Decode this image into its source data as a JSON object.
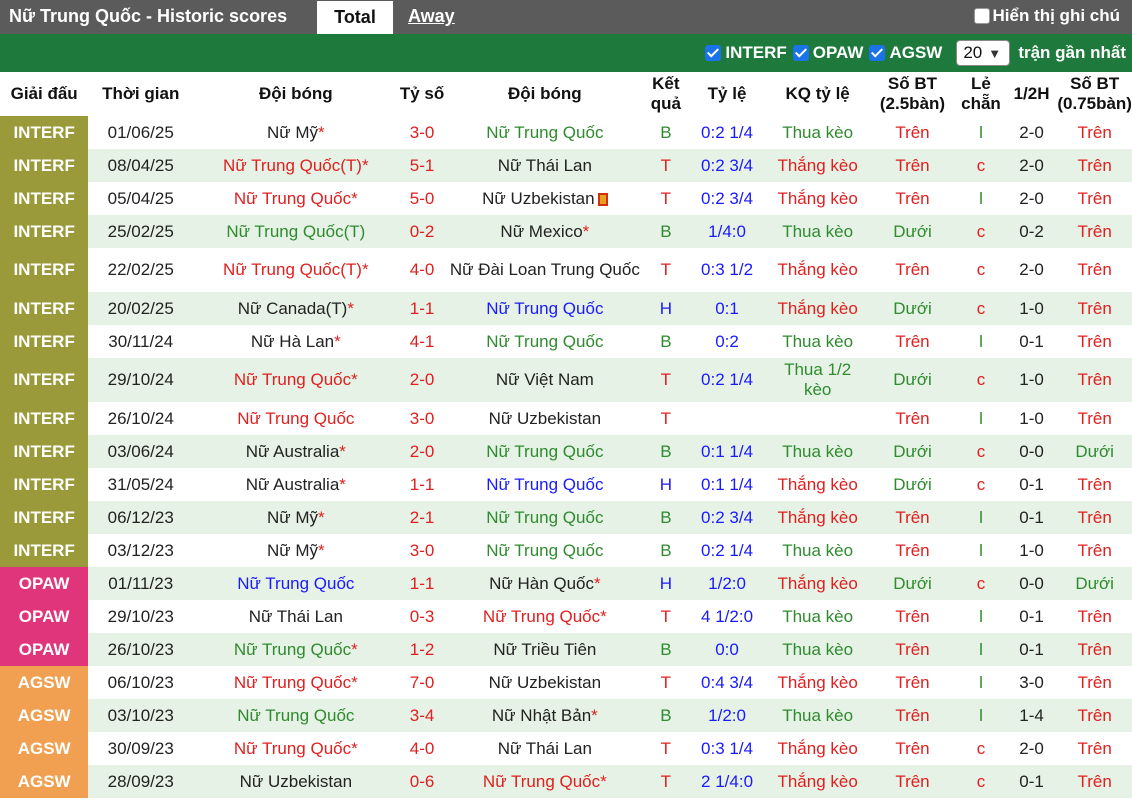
{
  "header": {
    "title": "Nữ Trung Quốc - Historic scores",
    "tab_total": "Total",
    "tab_away": "Away",
    "notes_label": "Hiển thị ghi chú"
  },
  "filters": {
    "items": [
      "INTERF",
      "OPAW",
      "AGSW"
    ],
    "count": "20",
    "count_suffix": "trận gần nhất"
  },
  "colors": {
    "INTERF": "#9a9a3a",
    "OPAW": "#e0357a",
    "AGSW": "#f0a050",
    "header_bar": "#5b5b5b",
    "filter_bar": "#1e7a3c"
  },
  "columns": [
    "Giải đấu",
    "Thời gian",
    "Đội bóng",
    "Tỷ số",
    "Đội bóng",
    "Kết quả",
    "Tỷ lệ",
    "KQ tỷ lệ",
    "Số BT (2.5bàn)",
    "Lẻ chẵn",
    "1/2H",
    "Số BT (0.75bàn)"
  ],
  "rows": [
    {
      "league": "INTERF",
      "date": "01/06/25",
      "home": "Nữ Mỹ",
      "hs": "*",
      "hc": "black",
      "score": "3-0",
      "away": "Nữ Trung Quốc",
      "as": "",
      "ac": "green",
      "res": "B",
      "odds": "0:2 1/4",
      "ko": "Thua kèo",
      "ou": "Trên",
      "oe": "l",
      "ht": "2-0",
      "ou2": "Trên"
    },
    {
      "league": "INTERF",
      "date": "08/04/25",
      "home": "Nữ Trung Quốc(T)",
      "hs": "*",
      "hc": "red",
      "score": "5-1",
      "away": "Nữ Thái Lan",
      "as": "",
      "ac": "black",
      "res": "T",
      "odds": "0:2 3/4",
      "ko": "Thắng kèo",
      "ou": "Trên",
      "oe": "c",
      "ht": "2-0",
      "ou2": "Trên"
    },
    {
      "league": "INTERF",
      "date": "05/04/25",
      "home": "Nữ Trung Quốc",
      "hs": "*",
      "hc": "red",
      "score": "5-0",
      "away": "Nữ Uzbekistan",
      "as": "",
      "ac": "black",
      "flag": true,
      "res": "T",
      "odds": "0:2 3/4",
      "ko": "Thắng kèo",
      "ou": "Trên",
      "oe": "l",
      "ht": "2-0",
      "ou2": "Trên"
    },
    {
      "league": "INTERF",
      "date": "25/02/25",
      "home": "Nữ Trung Quốc(T)",
      "hs": "",
      "hc": "green",
      "score": "0-2",
      "away": "Nữ Mexico",
      "as": "*",
      "ac": "black",
      "res": "B",
      "odds": "1/4:0",
      "ko": "Thua kèo",
      "ou": "Dưới",
      "oe": "c",
      "ht": "0-2",
      "ou2": "Trên"
    },
    {
      "league": "INTERF",
      "date": "22/02/25",
      "home": "Nữ Trung Quốc(T)",
      "hs": "*",
      "hc": "red",
      "score": "4-0",
      "away": "Nữ Đài Loan Trung Quốc",
      "as": "",
      "ac": "black",
      "res": "T",
      "odds": "0:3 1/2",
      "ko": "Thắng kèo",
      "ou": "Trên",
      "oe": "c",
      "ht": "2-0",
      "ou2": "Trên",
      "tall": true
    },
    {
      "league": "INTERF",
      "date": "20/02/25",
      "home": "Nữ Canada(T)",
      "hs": "*",
      "hc": "black",
      "score": "1-1",
      "away": "Nữ Trung Quốc",
      "as": "",
      "ac": "blue",
      "res": "H",
      "odds": "0:1",
      "ko": "Thắng kèo",
      "ou": "Dưới",
      "oe": "c",
      "ht": "1-0",
      "ou2": "Trên"
    },
    {
      "league": "INTERF",
      "date": "30/11/24",
      "home": "Nữ Hà Lan",
      "hs": "*",
      "hc": "black",
      "score": "4-1",
      "away": "Nữ Trung Quốc",
      "as": "",
      "ac": "green",
      "res": "B",
      "odds": "0:2",
      "ko": "Thua kèo",
      "ou": "Trên",
      "oe": "l",
      "ht": "0-1",
      "ou2": "Trên"
    },
    {
      "league": "INTERF",
      "date": "29/10/24",
      "home": "Nữ Trung Quốc",
      "hs": "*",
      "hc": "red",
      "score": "2-0",
      "away": "Nữ Việt Nam",
      "as": "",
      "ac": "black",
      "res": "T",
      "odds": "0:2 1/4",
      "ko": "Thua 1/2 kèo",
      "ou": "Dưới",
      "oe": "c",
      "ht": "1-0",
      "ou2": "Trên",
      "tall": true
    },
    {
      "league": "INTERF",
      "date": "26/10/24",
      "home": "Nữ Trung Quốc",
      "hs": "",
      "hc": "red",
      "score": "3-0",
      "away": "Nữ Uzbekistan",
      "as": "",
      "ac": "black",
      "res": "T",
      "odds": "",
      "ko": "",
      "ou": "Trên",
      "oe": "l",
      "ht": "1-0",
      "ou2": "Trên"
    },
    {
      "league": "INTERF",
      "date": "03/06/24",
      "home": "Nữ Australia",
      "hs": "*",
      "hc": "black",
      "score": "2-0",
      "away": "Nữ Trung Quốc",
      "as": "",
      "ac": "green",
      "res": "B",
      "odds": "0:1 1/4",
      "ko": "Thua kèo",
      "ou": "Dưới",
      "oe": "c",
      "ht": "0-0",
      "ou2": "Dưới"
    },
    {
      "league": "INTERF",
      "date": "31/05/24",
      "home": "Nữ Australia",
      "hs": "*",
      "hc": "black",
      "score": "1-1",
      "away": "Nữ Trung Quốc",
      "as": "",
      "ac": "blue",
      "res": "H",
      "odds": "0:1 1/4",
      "ko": "Thắng kèo",
      "ou": "Dưới",
      "oe": "c",
      "ht": "0-1",
      "ou2": "Trên"
    },
    {
      "league": "INTERF",
      "date": "06/12/23",
      "home": "Nữ Mỹ",
      "hs": "*",
      "hc": "black",
      "score": "2-1",
      "away": "Nữ Trung Quốc",
      "as": "",
      "ac": "green",
      "res": "B",
      "odds": "0:2 3/4",
      "ko": "Thắng kèo",
      "ou": "Trên",
      "oe": "l",
      "ht": "0-1",
      "ou2": "Trên"
    },
    {
      "league": "INTERF",
      "date": "03/12/23",
      "home": "Nữ Mỹ",
      "hs": "*",
      "hc": "black",
      "score": "3-0",
      "away": "Nữ Trung Quốc",
      "as": "",
      "ac": "green",
      "res": "B",
      "odds": "0:2 1/4",
      "ko": "Thua kèo",
      "ou": "Trên",
      "oe": "l",
      "ht": "1-0",
      "ou2": "Trên"
    },
    {
      "league": "OPAW",
      "date": "01/11/23",
      "home": "Nữ Trung Quốc",
      "hs": "",
      "hc": "blue",
      "score": "1-1",
      "away": "Nữ Hàn Quốc",
      "as": "*",
      "ac": "black",
      "res": "H",
      "odds": "1/2:0",
      "ko": "Thắng kèo",
      "ou": "Dưới",
      "oe": "c",
      "ht": "0-0",
      "ou2": "Dưới"
    },
    {
      "league": "OPAW",
      "date": "29/10/23",
      "home": "Nữ Thái Lan",
      "hs": "",
      "hc": "black",
      "score": "0-3",
      "away": "Nữ Trung Quốc",
      "as": "*",
      "ac": "red",
      "res": "T",
      "odds": "4 1/2:0",
      "ko": "Thua kèo",
      "ou": "Trên",
      "oe": "l",
      "ht": "0-1",
      "ou2": "Trên"
    },
    {
      "league": "OPAW",
      "date": "26/10/23",
      "home": "Nữ Trung Quốc",
      "hs": "*",
      "hc": "green",
      "score": "1-2",
      "away": "Nữ Triều Tiên",
      "as": "",
      "ac": "black",
      "res": "B",
      "odds": "0:0",
      "ko": "Thua kèo",
      "ou": "Trên",
      "oe": "l",
      "ht": "0-1",
      "ou2": "Trên"
    },
    {
      "league": "AGSW",
      "date": "06/10/23",
      "home": "Nữ Trung Quốc",
      "hs": "*",
      "hc": "red",
      "score": "7-0",
      "away": "Nữ Uzbekistan",
      "as": "",
      "ac": "black",
      "res": "T",
      "odds": "0:4 3/4",
      "ko": "Thắng kèo",
      "ou": "Trên",
      "oe": "l",
      "ht": "3-0",
      "ou2": "Trên"
    },
    {
      "league": "AGSW",
      "date": "03/10/23",
      "home": "Nữ Trung Quốc",
      "hs": "",
      "hc": "green",
      "score": "3-4",
      "away": "Nữ Nhật Bản",
      "as": "*",
      "ac": "black",
      "res": "B",
      "odds": "1/2:0",
      "ko": "Thua kèo",
      "ou": "Trên",
      "oe": "l",
      "ht": "1-4",
      "ou2": "Trên"
    },
    {
      "league": "AGSW",
      "date": "30/09/23",
      "home": "Nữ Trung Quốc",
      "hs": "*",
      "hc": "red",
      "score": "4-0",
      "away": "Nữ Thái Lan",
      "as": "",
      "ac": "black",
      "res": "T",
      "odds": "0:3 1/4",
      "ko": "Thắng kèo",
      "ou": "Trên",
      "oe": "c",
      "ht": "2-0",
      "ou2": "Trên"
    },
    {
      "league": "AGSW",
      "date": "28/09/23",
      "home": "Nữ Uzbekistan",
      "hs": "",
      "hc": "black",
      "score": "0-6",
      "away": "Nữ Trung Quốc",
      "as": "*",
      "ac": "red",
      "res": "T",
      "odds": "2 1/4:0",
      "ko": "Thắng kèo",
      "ou": "Trên",
      "oe": "c",
      "ht": "0-1",
      "ou2": "Trên"
    }
  ]
}
